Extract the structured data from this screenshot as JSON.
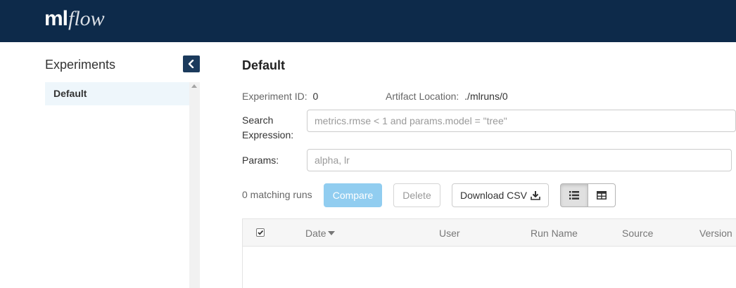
{
  "header": {
    "logo_ml": "ml",
    "logo_flow": "flow"
  },
  "sidebar": {
    "title": "Experiments",
    "items": [
      {
        "label": "Default",
        "selected": true
      }
    ]
  },
  "experiment": {
    "title": "Default",
    "id_label": "Experiment ID:",
    "id_value": "0",
    "artifact_label": "Artifact Location:",
    "artifact_value": "./mlruns/0"
  },
  "search": {
    "label_line1": "Search",
    "label_line2": "Expression:",
    "placeholder": "metrics.rmse < 1 and params.model = \"tree\"",
    "value": ""
  },
  "params": {
    "label": "Params:",
    "placeholder": "alpha, lr",
    "value": ""
  },
  "toolbar": {
    "matching_runs": "0 matching runs",
    "compare_label": "Compare",
    "delete_label": "Delete",
    "download_label": "Download CSV",
    "list_view_icon": "list-icon",
    "table_view_icon": "table-icon"
  },
  "table": {
    "columns": [
      "Date",
      "User",
      "Run Name",
      "Source",
      "Version"
    ],
    "rows": []
  },
  "colors": {
    "topbar": "#0d2a4a",
    "compare_disabled": "#91cdf0",
    "selected_item_bg": "#eef6fb"
  }
}
